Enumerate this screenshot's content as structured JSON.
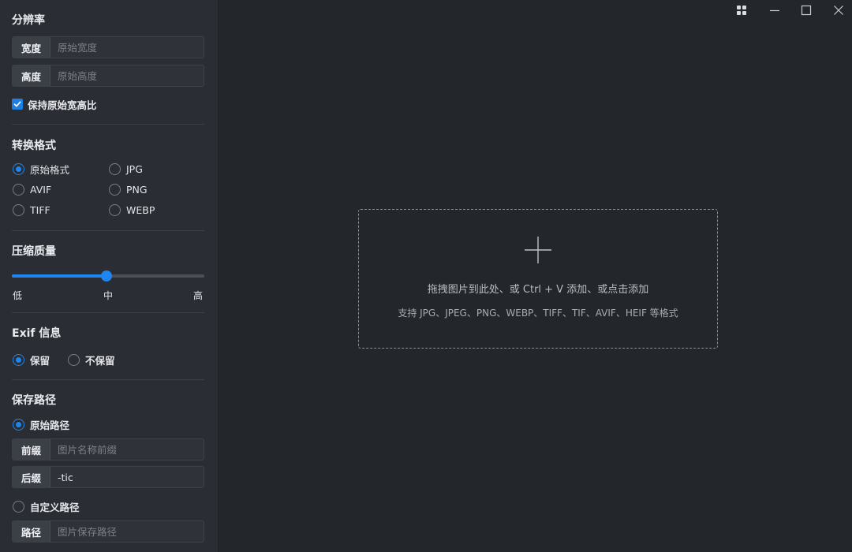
{
  "resolution": {
    "title": "分辨率",
    "width_label": "宽度",
    "width_placeholder": "原始宽度",
    "width_value": "",
    "height_label": "高度",
    "height_placeholder": "原始高度",
    "height_value": "",
    "keep_ratio_label": "保持原始宽高比",
    "keep_ratio_checked": true
  },
  "format": {
    "title": "转换格式",
    "options": [
      "原始格式",
      "JPG",
      "AVIF",
      "PNG",
      "TIFF",
      "WEBP"
    ],
    "selected": "原始格式"
  },
  "quality": {
    "title": "压缩质量",
    "level_fraction": 0.5,
    "marks": [
      "低",
      "中",
      "高"
    ]
  },
  "exif": {
    "title": "Exif 信息",
    "options": [
      "保留",
      "不保留"
    ],
    "selected": "保留"
  },
  "save_path": {
    "title": "保存路径",
    "original_label": "原始路径",
    "original_selected": true,
    "prefix_label": "前缀",
    "prefix_placeholder": "图片名称前缀",
    "prefix_value": "",
    "suffix_label": "后缀",
    "suffix_placeholder": "",
    "suffix_value": "-tic",
    "custom_label": "自定义路径",
    "custom_selected": false,
    "path_label": "路径",
    "path_placeholder": "图片保存路径",
    "path_value": ""
  },
  "window_controls": {
    "icons": [
      "grid-icon",
      "minimize-icon",
      "maximize-icon",
      "close-icon"
    ]
  },
  "dropzone": {
    "icon": "plus-icon",
    "primary_text": "拖拽图片到此处、或 Ctrl + V 添加、或点击添加",
    "secondary_text": "支持 JPG、JPEG、PNG、WEBP、TIFF、TIF、AVIF、HEIF 等格式"
  },
  "colors": {
    "accent": "#1f85f0",
    "sidebar_bg": "#2a2d33",
    "main_bg": "#23262b"
  }
}
